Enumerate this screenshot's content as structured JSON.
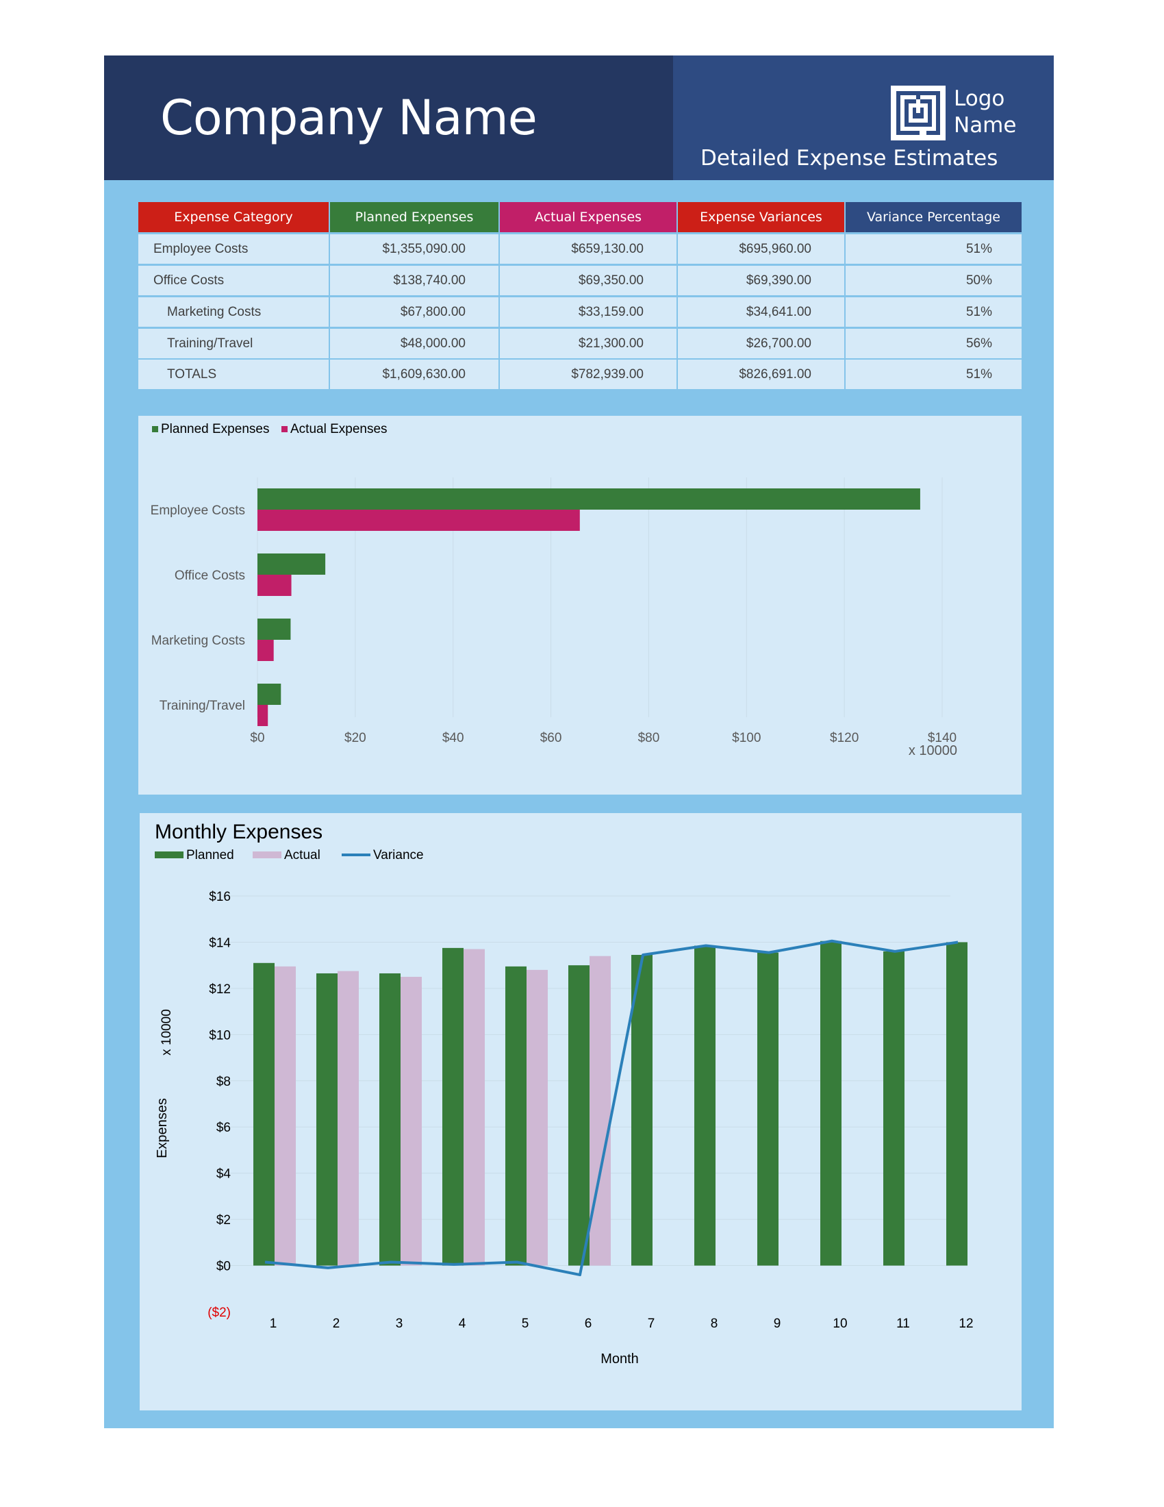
{
  "header": {
    "company_name": "Company Name",
    "logo_line1": "Logo",
    "logo_line2": "Name",
    "report_title": "Detailed Expense Estimates",
    "logo_icon": "maze-logo-icon"
  },
  "colors": {
    "navy": "#243761",
    "blue": "#2e4b82",
    "red": "#cc1f17",
    "green": "#377c3a",
    "magenta": "#c11f68",
    "lavender": "#cfb8d4",
    "variance_line": "#2b80b9",
    "sheet_bg": "#84c4ea",
    "panel_bg": "#d6eaf8"
  },
  "table": {
    "headers": [
      "Expense Category",
      "Planned Expenses",
      "Actual Expenses",
      "Expense Variances",
      "Variance Percentage"
    ],
    "rows": [
      [
        "Employee Costs",
        "$1,355,090.00",
        "$659,130.00",
        "$695,960.00",
        "51%"
      ],
      [
        "Office Costs",
        "$138,740.00",
        "$69,350.00",
        "$69,390.00",
        "50%"
      ],
      [
        "Marketing Costs",
        "$67,800.00",
        "$33,159.00",
        "$34,641.00",
        "51%"
      ],
      [
        "Training/Travel",
        "$48,000.00",
        "$21,300.00",
        "$26,700.00",
        "56%"
      ],
      [
        "TOTALS",
        "$1,609,630.00",
        "$782,939.00",
        "$826,691.00",
        "51%"
      ]
    ]
  },
  "chart_data": [
    {
      "type": "bar",
      "orientation": "horizontal",
      "categories": [
        "Employee Costs",
        "Office Costs",
        "Marketing Costs",
        "Training/Travel"
      ],
      "series": [
        {
          "name": "Planned Expenses",
          "values": [
            1355090,
            138740,
            67800,
            48000
          ]
        },
        {
          "name": "Actual Expenses",
          "values": [
            659130,
            69350,
            33159,
            21300
          ]
        }
      ],
      "xlim": [
        0,
        1400000
      ],
      "x_ticks": [
        "$0",
        "$20",
        "$40",
        "$60",
        "$80",
        "$100",
        "$120",
        "$140"
      ],
      "display_unit": "x 10000",
      "legend": "top-left",
      "grid": true
    },
    {
      "type": "bar",
      "title": "Monthly Expenses",
      "xlabel": "Month",
      "ylabel": "Expenses",
      "display_unit": "x 10000",
      "categories": [
        "1",
        "2",
        "3",
        "4",
        "5",
        "6",
        "7",
        "8",
        "9",
        "10",
        "11",
        "12"
      ],
      "series": [
        {
          "name": "Planned",
          "type": "bar",
          "values": [
            131000,
            126500,
            126500,
            137500,
            129500,
            130000,
            134500,
            138500,
            135500,
            140500,
            136000,
            140000
          ]
        },
        {
          "name": "Actual",
          "type": "bar",
          "values": [
            129500,
            127500,
            125000,
            137000,
            128000,
            134000,
            null,
            null,
            null,
            null,
            null,
            null
          ]
        },
        {
          "name": "Variance",
          "type": "line",
          "values": [
            1500,
            -1000,
            1500,
            500,
            1500,
            -4000,
            134500,
            138500,
            135500,
            140500,
            136000,
            140000
          ]
        }
      ],
      "ylim": [
        -20000,
        160000
      ],
      "y_ticks": [
        "($2)",
        "$0",
        "$2",
        "$4",
        "$6",
        "$8",
        "$10",
        "$12",
        "$14",
        "$16"
      ],
      "legend": "top-left",
      "grid": true
    }
  ]
}
